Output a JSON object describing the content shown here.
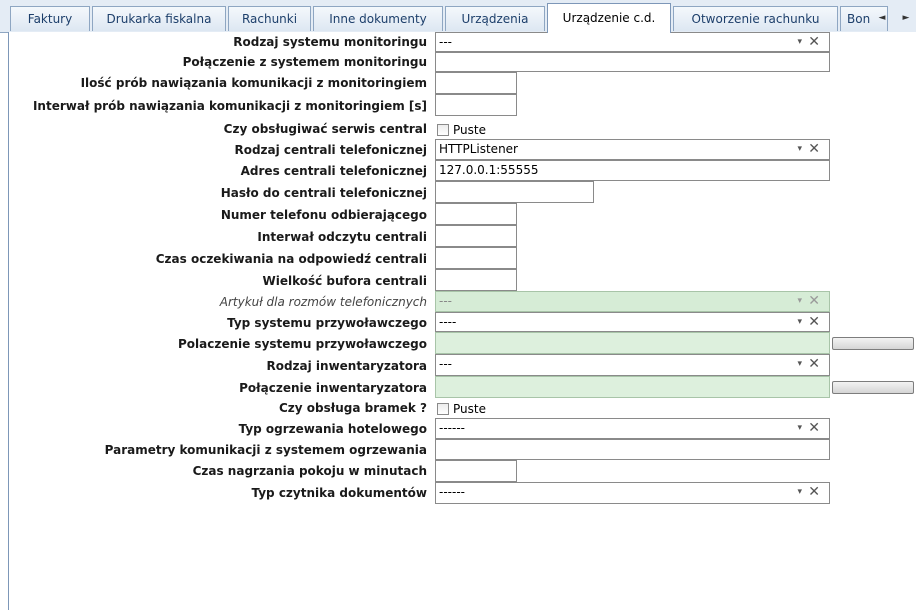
{
  "tabs": [
    "Faktury",
    "Drukarka fiskalna",
    "Rachunki",
    "Inne dokumenty",
    "Urządzenia",
    "Urządzenie c.d.",
    "Otworzenie rachunku",
    "Bon"
  ],
  "active_tab": "Urządzenie c.d.",
  "tab_nav": {
    "left": "◄",
    "right": "►"
  },
  "combo_glyphs": {
    "arrow": "▾",
    "clear": "✕"
  },
  "fields": {
    "rodzaj_monitoringu": {
      "label": "Rodzaj systemu monitoringu",
      "value": "---"
    },
    "polaczenie_monitoringu": {
      "label": "Połączenie z systemem monitoringu",
      "value": ""
    },
    "ilosc_prob": {
      "label": "Ilość prób nawiązania komunikacji z monitoringiem",
      "value": ""
    },
    "interwal_prob": {
      "label": "Interwał prób nawiązania komunikacji z monitoringiem [s]",
      "value": ""
    },
    "obsluga_serwis_central": {
      "label": "Czy obsługiwać serwis central",
      "checkbox_label": "Puste",
      "checked": false
    },
    "rodzaj_centrali": {
      "label": "Rodzaj centrali telefonicznej",
      "value": "HTTPListener"
    },
    "adres_centrali": {
      "label": "Adres centrali telefonicznej",
      "value": "127.0.0.1:55555"
    },
    "haslo_centrali": {
      "label": "Hasło do centrali telefonicznej",
      "value": ""
    },
    "numer_telefonu": {
      "label": "Numer telefonu odbierającego",
      "value": ""
    },
    "interwal_odczytu": {
      "label": "Interwał odczytu centrali",
      "value": ""
    },
    "czas_oczekiwania": {
      "label": "Czas oczekiwania na odpowiedź centrali",
      "value": ""
    },
    "wielkosc_bufora": {
      "label": "Wielkość bufora centrali",
      "value": ""
    },
    "artykul_rozmow": {
      "label": "Artykuł dla rozmów telefonicznych",
      "value": "---"
    },
    "typ_przywolawczego": {
      "label": "Typ systemu przywoławczego",
      "value": "----"
    },
    "polaczenie_przywolawczego": {
      "label": "Polaczenie systemu przywoławczego",
      "value": ""
    },
    "rodzaj_inwentaryzatora": {
      "label": "Rodzaj inwentaryzatora",
      "value": "---"
    },
    "polaczenie_inwentaryzatora": {
      "label": "Połączenie inwentaryzatora",
      "value": ""
    },
    "obsluga_bramek": {
      "label": "Czy obsługa bramek ?",
      "checkbox_label": "Puste",
      "checked": false
    },
    "typ_ogrzewania": {
      "label": "Typ ogrzewania hotelowego",
      "value": "------"
    },
    "parametry_ogrzewania": {
      "label": "Parametry komunikacji z systemem ogrzewania",
      "value": ""
    },
    "czas_nagrzania": {
      "label": "Czas nagrzania pokoju w minutach",
      "value": ""
    },
    "typ_czytnika": {
      "label": "Typ czytnika dokumentów",
      "value": "------"
    }
  }
}
